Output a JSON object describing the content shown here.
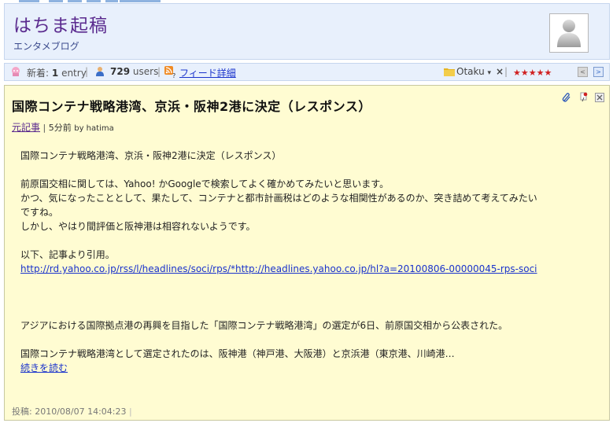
{
  "site": {
    "title": "はちま起稿",
    "subtitle": "エンタメブログ"
  },
  "toolbar": {
    "new_label": "新着:",
    "new_count": "1",
    "new_unit": "entry",
    "sep1": "|",
    "users_count": "729",
    "users_unit": "users",
    "sep2": "|",
    "feed_link": "フィード詳細",
    "category": "Otaku",
    "dropdown_arrow": "▾",
    "close_x": "×",
    "sep3": "|",
    "stars": "★★★★★",
    "rating": 5,
    "prev_label": "<",
    "next_label": ">"
  },
  "entry": {
    "title": "国際コンテナ戦略港湾、京浜・阪神2港に決定（レスポンス）",
    "source_link": "元記事",
    "meta_sep": "|",
    "time_ago": "5分前",
    "author": "by hatima",
    "lines": {
      "l1": "国際コンテナ戦略港湾、京浜・阪神2港に決定（レスポンス）",
      "l2": "前原国交相に関しては、Yahoo! かGoogleで検索してよく確かめてみたいと思います。",
      "l3": "かつ、気になったこととして、果たして、コンテナと都市計画税はどのような相関性があるのか、突き詰めて考えてみたい",
      "l4": "ですね。",
      "l5": "しかし、やはり間評価と阪神港は相容れないようです。",
      "l6": "以下、記事より引用。",
      "l7_link": "http://rd.yahoo.co.jp/rss/l/headlines/soci/rps/*http://headlines.yahoo.co.jp/hl?a=20100806-00000045-rps-soci",
      "l8": "アジアにおける国際拠点港の再興を目指した「国際コンテナ戦略港湾」の選定が6日、前原国交相から公表された。",
      "l9": "国際コンテナ戦略港湾として選定されたのは、阪神港（神戸港、大阪港）と京浜港（東京港、川崎港…",
      "read_more": "続きを読む"
    },
    "posted": "投稿: 2010/08/07 14:04:23",
    "posted_sep": "|"
  },
  "colors": {
    "header_bg": "#e8f0fc",
    "card_bg": "#fffcd2",
    "title_purple": "#5a2a8e",
    "link_blue": "#1a33cc",
    "star_red": "#d02020"
  },
  "icons": [
    "user-avatar-icon",
    "new-items-icon",
    "users-icon",
    "rss-feed-icon",
    "folder-icon",
    "paperclip-icon",
    "pin-icon",
    "close-icon"
  ]
}
